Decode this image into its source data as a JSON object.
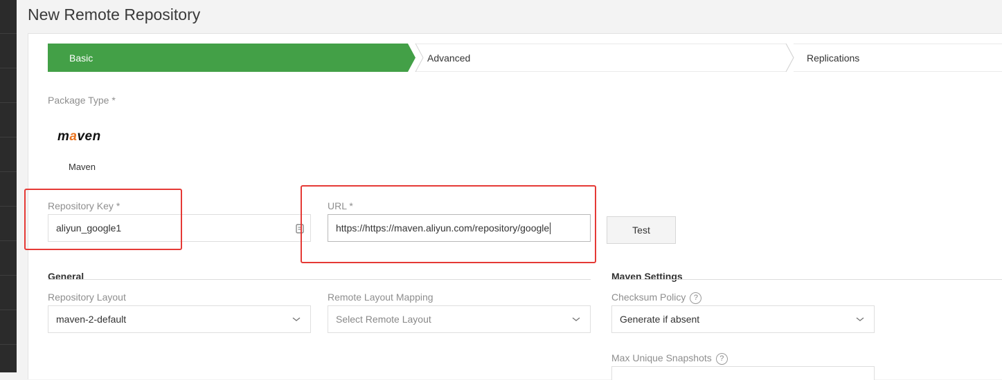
{
  "page": {
    "title": "New Remote Repository"
  },
  "wizard": {
    "steps": [
      {
        "label": "Basic",
        "active": true
      },
      {
        "label": "Advanced",
        "active": false
      },
      {
        "label": "Replications",
        "active": false
      }
    ],
    "active_color": "#43a047"
  },
  "package_type": {
    "label": "Package Type *",
    "logo_text": "maven",
    "name": "Maven",
    "logo_accent": "#e8731f"
  },
  "repository_key": {
    "label": "Repository Key *",
    "value": "aliyun_google1"
  },
  "url": {
    "label": "URL *",
    "value": "https://https://maven.aliyun.com/repository/google"
  },
  "test_button": {
    "label": "Test"
  },
  "general": {
    "title": "General",
    "repository_layout": {
      "label": "Repository Layout",
      "value": "maven-2-default"
    },
    "remote_layout_mapping": {
      "label": "Remote Layout Mapping",
      "placeholder": "Select Remote Layout"
    }
  },
  "maven_settings": {
    "title": "Maven Settings",
    "checksum_policy": {
      "label": "Checksum Policy",
      "value": "Generate if absent",
      "help": "?"
    },
    "max_unique_snapshots": {
      "label": "Max Unique Snapshots",
      "help": "?"
    }
  },
  "annotation_color": "#e53935"
}
